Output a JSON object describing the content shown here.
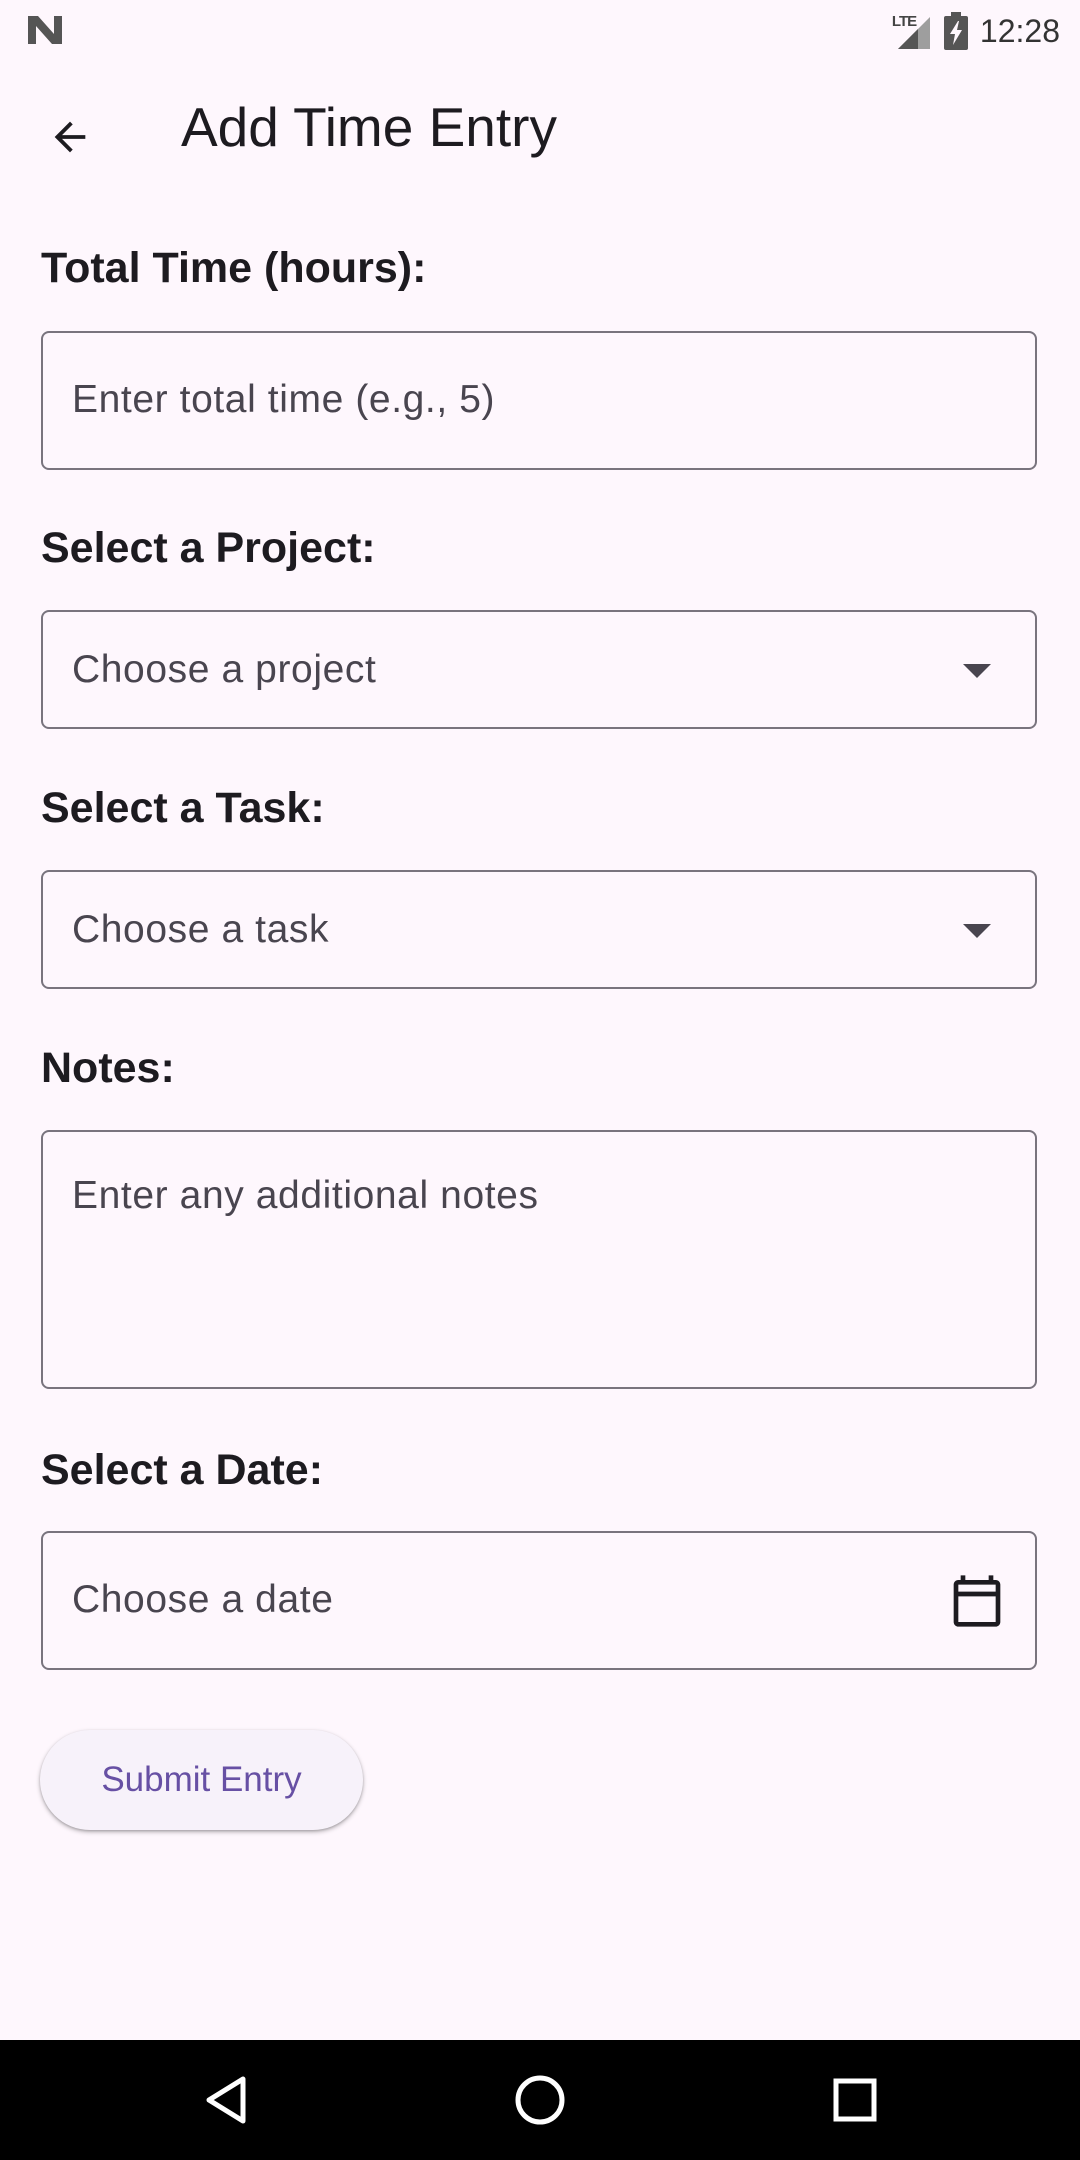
{
  "status_bar": {
    "time": "12:28",
    "network_label": "LTE",
    "icons": [
      "notification-n-icon",
      "signal-icon",
      "battery-charging-icon"
    ]
  },
  "app_bar": {
    "title": "Add Time Entry",
    "back_icon": "arrow-left-icon"
  },
  "form": {
    "total_time": {
      "label": "Total Time (hours):",
      "placeholder": "Enter total time (e.g., 5)",
      "value": ""
    },
    "project": {
      "label": "Select a Project:",
      "selected": "Choose a project",
      "icon": "dropdown-arrow-icon"
    },
    "task": {
      "label": "Select a Task:",
      "selected": "Choose a task",
      "icon": "dropdown-arrow-icon"
    },
    "notes": {
      "label": "Notes:",
      "placeholder": "Enter any additional notes",
      "value": ""
    },
    "date": {
      "label": "Select a Date:",
      "placeholder": "Choose a date",
      "icon": "calendar-icon"
    },
    "submit_label": "Submit Entry"
  },
  "nav_bar": {
    "icons": [
      "back-triangle-icon",
      "home-circle-icon",
      "recents-square-icon"
    ]
  },
  "colors": {
    "background": "#fef7fd",
    "primary": "#6750a4",
    "outline": "#79747e",
    "on_surface": "#1d1b20",
    "nav_bar": "#000000"
  }
}
